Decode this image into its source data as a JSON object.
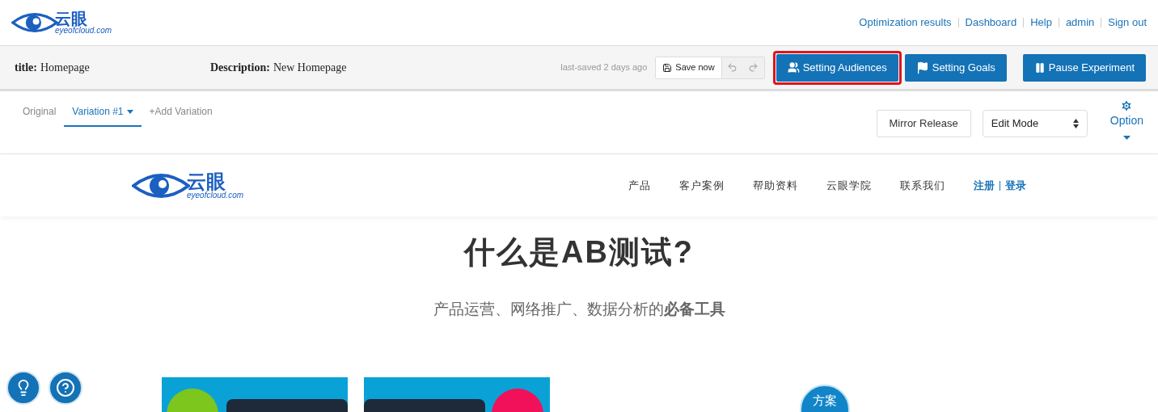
{
  "header": {
    "logo": {
      "name": "云眼",
      "domain": "eyeofcloud.com"
    },
    "links": [
      "Optimization results",
      "Dashboard",
      "Help",
      "admin",
      "Sign out"
    ]
  },
  "toolbar": {
    "title_label": "title:",
    "title_value": "Homepage",
    "description_label": "Description:",
    "description_value": "New Homepage",
    "saved": "last-saved 2 days ago",
    "save_button": "Save now",
    "undo_disabled": true,
    "redo_disabled": true,
    "actions": [
      {
        "kind": "audiences",
        "label": "Setting Audiences",
        "highlighted": true
      },
      {
        "kind": "goals",
        "label": "Setting Goals",
        "highlighted": false
      },
      {
        "kind": "pause",
        "label": "Pause Experiment",
        "highlighted": false
      }
    ]
  },
  "tabs": [
    {
      "label": "Original",
      "selected": false,
      "dropdown": false
    },
    {
      "label": "Variation #1",
      "selected": true,
      "dropdown": true
    },
    {
      "label": "+Add Variation",
      "selected": false,
      "dropdown": false
    }
  ],
  "editor_controls": {
    "mirror_button": "Mirror Release",
    "mode_select": "Edit Mode",
    "option": "Option"
  },
  "preview": {
    "logo": {
      "name": "云眼",
      "domain": "eyeofcloud.com"
    },
    "nav": [
      "产品",
      "客户案例",
      "帮助资料",
      "云眼学院",
      "联系我们"
    ],
    "register": "注册",
    "login": "登录",
    "heading": "什么是AB测试?",
    "subtitle": "产品运营、网络推广、数据分析的**必备工具**",
    "cards": [
      {
        "color": "#7dc61e"
      },
      {
        "color": "#f0115a"
      }
    ],
    "bubble": "方案"
  }
}
